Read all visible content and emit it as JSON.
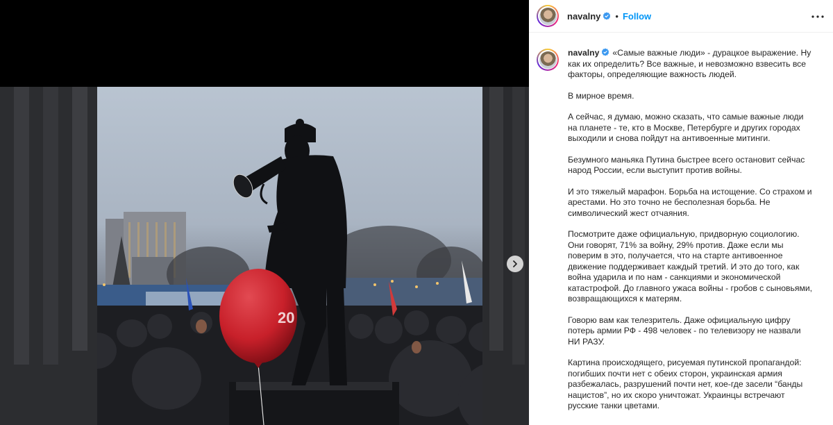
{
  "post": {
    "username": "navalny",
    "follow_label": "Follow",
    "separator": "•",
    "caption_paragraphs": [
      "«Самые важные люди» - дурацкое выражение. Ну как их определить? Все важные, и невозможно взвесить все факторы, определяющие важность людей.",
      "В мирное время.",
      "А сейчас, я думаю, можно сказать, что самые важные люди на планете - те, кто в Москве, Петербурге и других городах выходили и снова пойдут на антивоенные митинги.",
      "Безумного маньяка Путина быстрее всего остановит сейчас народ России, если выступит против войны.",
      "И это тяжелый марафон. Борьба на истощение. Со страхом и арестами. Но это точно не бесполезная борьба. Не символический жест отчаяния.",
      "Посмотрите даже официальную, придворную социологию. Они говорят, 71% за войну, 29% против. Даже если мы поверим в это, получается, что на старте антивоенное движение поддерживает каждый третий. И это до того, как война ударила и по нам  - санкциями и экономической катастрофой. До главного ужаса войны - гробов с сыновьями, возвращающихся к матерям.",
      "Говорю вам как телезритель. Даже официальную цифру потерь армии РФ - 498 человек - по телевизору не назвали НИ РАЗУ.",
      "Картина происходящего, рисуемая путинской пропагандой: погибших почти нет с обеих сторон, украинская армия разбежалась, разрушений почти нет, кое-где засели “банды нацистов”, но их скоро уничтожат. Украинцы встречают русские танки цветами."
    ]
  },
  "photo": {
    "balloon_text": "20"
  },
  "icons": {
    "verified": "verified-badge-icon",
    "more": "more-options-icon",
    "next": "chevron-right-icon"
  },
  "colors": {
    "follow": "#0095f6",
    "verified": "#3897f0",
    "text": "#262626",
    "balloon": "#c8202a"
  }
}
